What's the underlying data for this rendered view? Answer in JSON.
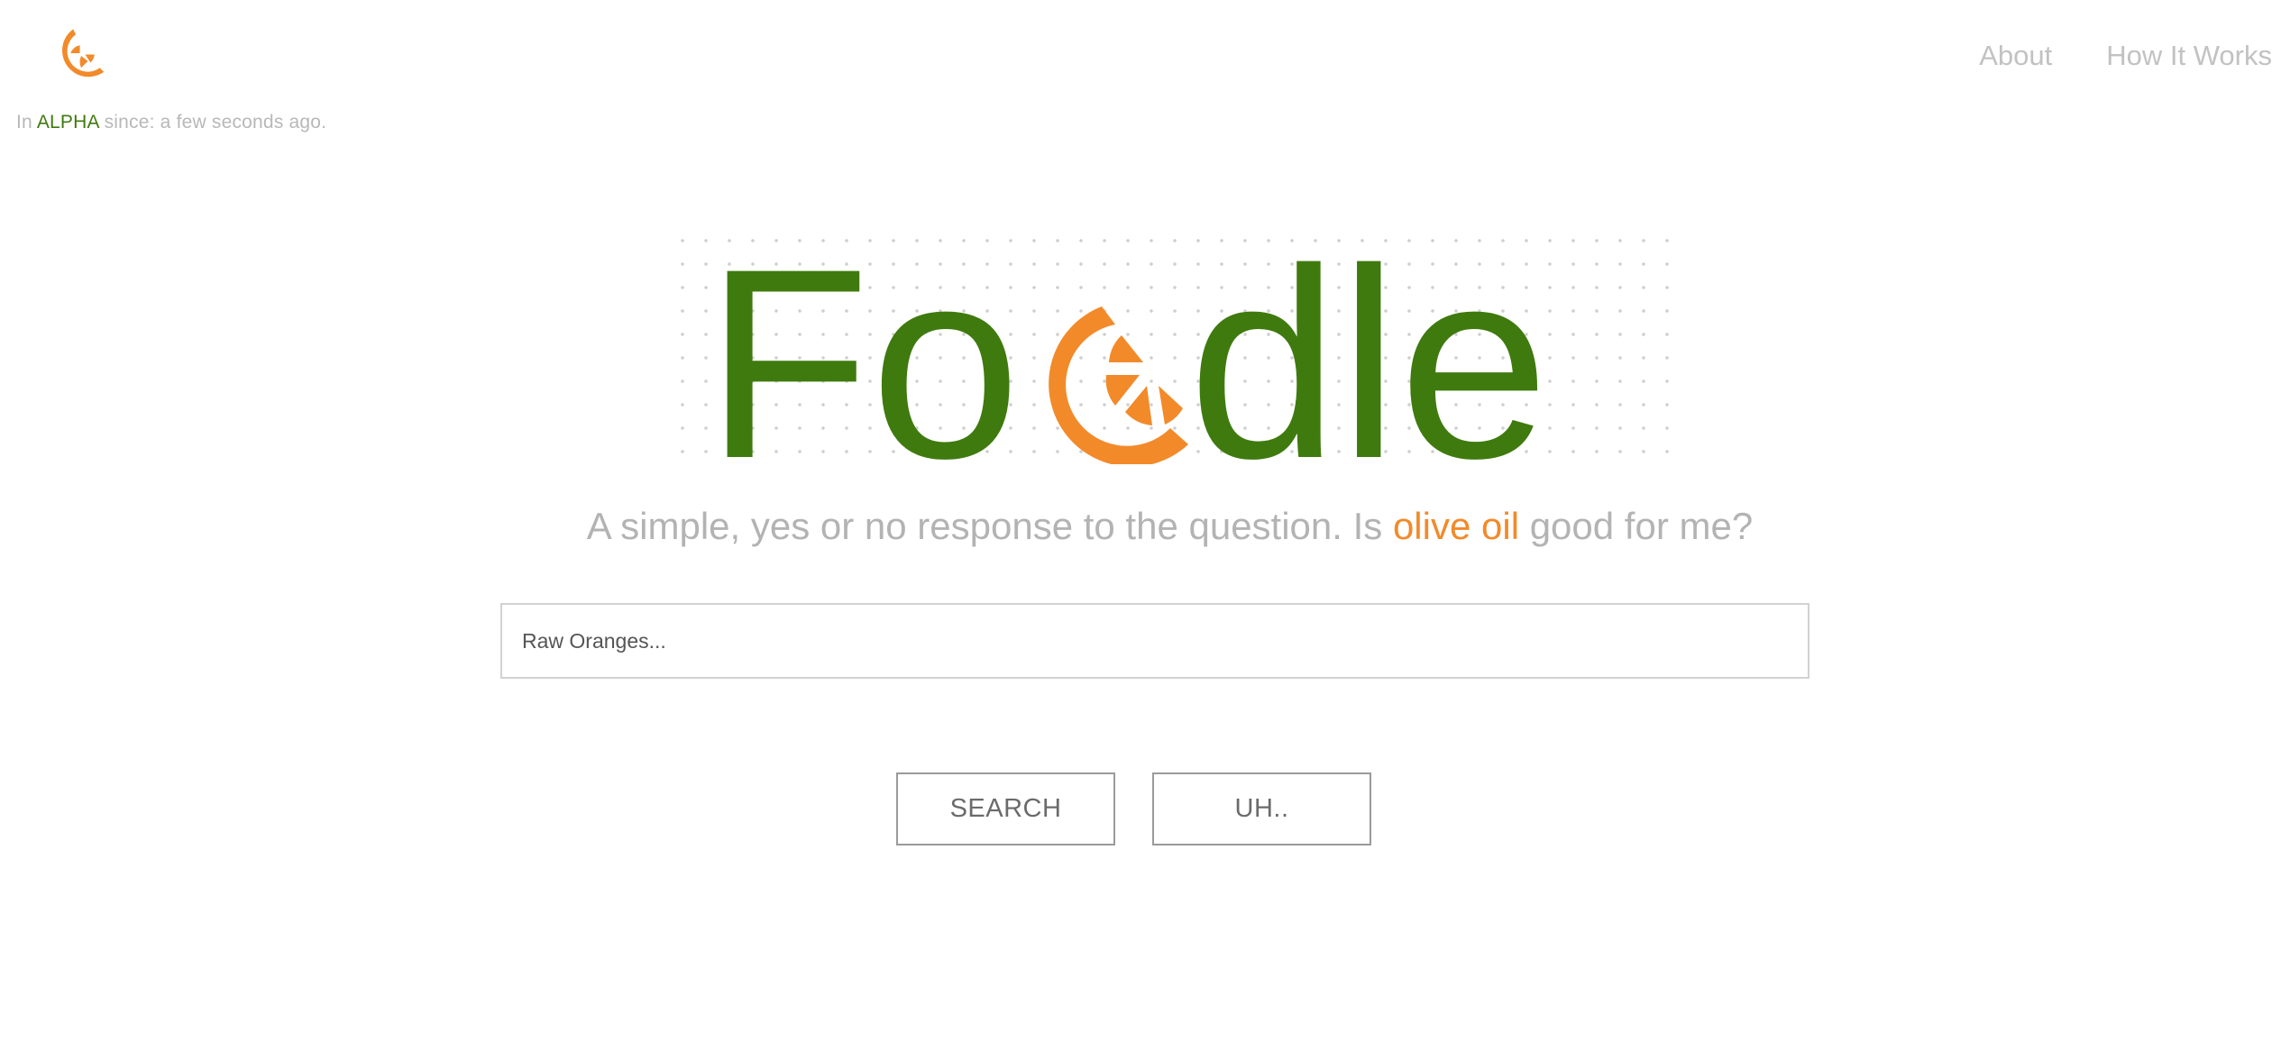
{
  "header": {
    "alpha_prefix": "In",
    "alpha_word": "ALPHA",
    "alpha_suffix": "since: a few seconds ago."
  },
  "nav": {
    "about": "About",
    "how_it_works": "How It Works"
  },
  "hero": {
    "title_left": "Fo",
    "title_right": "dle",
    "logo_icon": "orange-slice-icon"
  },
  "tagline": {
    "prefix": "A simple, yes or no response to the question. Is",
    "food": "olive oil",
    "suffix": "good for me?"
  },
  "search": {
    "placeholder": "Raw Oranges..."
  },
  "buttons": {
    "search": "SEARCH",
    "uh": "UH.."
  },
  "colors": {
    "brand_green": "#3f7a0e",
    "brand_orange": "#f28a2a",
    "muted_gray": "#b3b3b3"
  }
}
